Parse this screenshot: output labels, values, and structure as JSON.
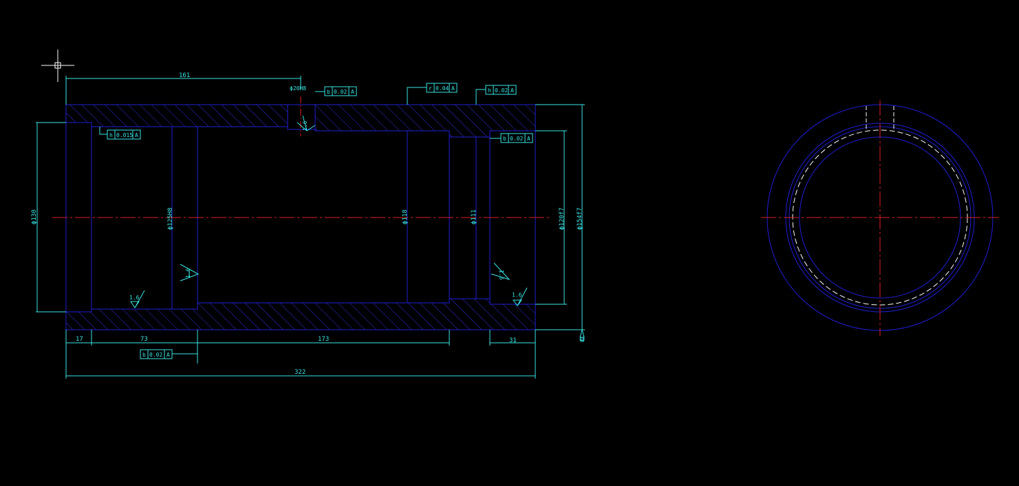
{
  "colors": {
    "background": "#000000",
    "outline": "#1f1fd6",
    "dimension": "#3ae6e6",
    "centerline": "#e02020",
    "hatch": "#2f2fe0",
    "cursor": "#ffffff"
  },
  "dimensions": {
    "top_161": "161",
    "hole_dia": "ϕ20H8",
    "dia_130": "ϕ130",
    "dia_125": "ϕ125H8",
    "dia_118": "ϕ118",
    "dia_111": "ϕ111",
    "dia_120": "ϕ120f7",
    "dia_154": "ϕ154f7",
    "bottom_17": "17",
    "bottom_73": "73",
    "bottom_173": "173",
    "bottom_31": "31",
    "overall_322": "322"
  },
  "surface_finish": {
    "hole": "1.6",
    "bore_left": "1.6",
    "bore_mid": "1.6",
    "step": "1.6",
    "right_bore": "1.6"
  },
  "tolerance_frames": [
    {
      "symbol": "b",
      "value": "0.02",
      "datum": "A"
    },
    {
      "symbol": "r",
      "value": "0.04",
      "datum": "A"
    },
    {
      "symbol": "h",
      "value": "0.02",
      "datum": "A"
    },
    {
      "symbol": "h",
      "value": "0.015",
      "datum": "A"
    },
    {
      "symbol": "b",
      "value": "0.02",
      "datum": "A"
    },
    {
      "symbol": "b",
      "value": "0.02",
      "datum": "A"
    }
  ],
  "datum_label": "A"
}
